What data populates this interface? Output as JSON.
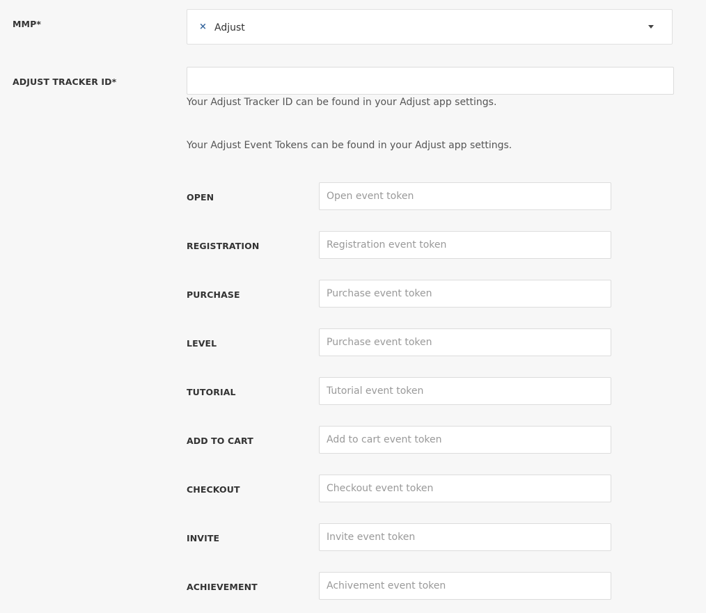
{
  "mmp": {
    "label": "MMP*",
    "selected_value": "Adjust",
    "clear_icon": "×"
  },
  "tracker": {
    "label": "ADJUST TRACKER ID*",
    "value": "",
    "help": "Your Adjust Tracker ID can be found in your Adjust app settings."
  },
  "event_tokens_help": "Your Adjust Event Tokens can be found in your Adjust app settings.",
  "events": [
    {
      "label": "OPEN",
      "placeholder": "Open event token"
    },
    {
      "label": "REGISTRATION",
      "placeholder": "Registration event token"
    },
    {
      "label": "PURCHASE",
      "placeholder": "Purchase event token"
    },
    {
      "label": "LEVEL",
      "placeholder": "Purchase event token"
    },
    {
      "label": "TUTORIAL",
      "placeholder": "Tutorial event token"
    },
    {
      "label": "ADD TO CART",
      "placeholder": "Add to cart event token"
    },
    {
      "label": "CHECKOUT",
      "placeholder": "Checkout event token"
    },
    {
      "label": "INVITE",
      "placeholder": "Invite event token"
    },
    {
      "label": "ACHIEVEMENT",
      "placeholder": "Achivement event token"
    }
  ],
  "colors": {
    "background": "#f7f7f7",
    "clear_icon": "#3b6aa0",
    "label_text": "#333333",
    "placeholder": "#999999"
  }
}
